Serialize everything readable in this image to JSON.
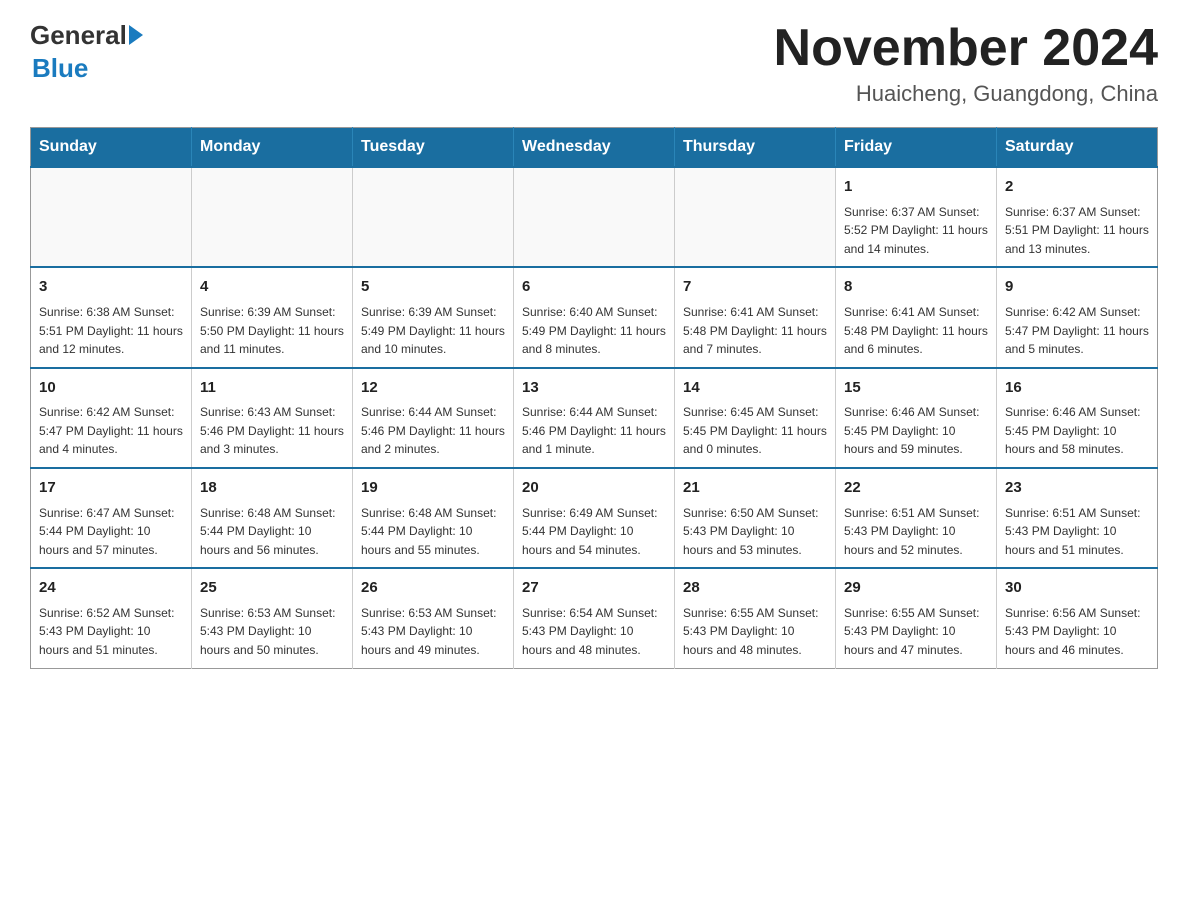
{
  "header": {
    "logo_general": "General",
    "logo_blue": "Blue",
    "month_title": "November 2024",
    "location": "Huaicheng, Guangdong, China"
  },
  "days_of_week": [
    "Sunday",
    "Monday",
    "Tuesday",
    "Wednesday",
    "Thursday",
    "Friday",
    "Saturday"
  ],
  "weeks": [
    [
      {
        "day": "",
        "info": ""
      },
      {
        "day": "",
        "info": ""
      },
      {
        "day": "",
        "info": ""
      },
      {
        "day": "",
        "info": ""
      },
      {
        "day": "",
        "info": ""
      },
      {
        "day": "1",
        "info": "Sunrise: 6:37 AM\nSunset: 5:52 PM\nDaylight: 11 hours and 14 minutes."
      },
      {
        "day": "2",
        "info": "Sunrise: 6:37 AM\nSunset: 5:51 PM\nDaylight: 11 hours and 13 minutes."
      }
    ],
    [
      {
        "day": "3",
        "info": "Sunrise: 6:38 AM\nSunset: 5:51 PM\nDaylight: 11 hours and 12 minutes."
      },
      {
        "day": "4",
        "info": "Sunrise: 6:39 AM\nSunset: 5:50 PM\nDaylight: 11 hours and 11 minutes."
      },
      {
        "day": "5",
        "info": "Sunrise: 6:39 AM\nSunset: 5:49 PM\nDaylight: 11 hours and 10 minutes."
      },
      {
        "day": "6",
        "info": "Sunrise: 6:40 AM\nSunset: 5:49 PM\nDaylight: 11 hours and 8 minutes."
      },
      {
        "day": "7",
        "info": "Sunrise: 6:41 AM\nSunset: 5:48 PM\nDaylight: 11 hours and 7 minutes."
      },
      {
        "day": "8",
        "info": "Sunrise: 6:41 AM\nSunset: 5:48 PM\nDaylight: 11 hours and 6 minutes."
      },
      {
        "day": "9",
        "info": "Sunrise: 6:42 AM\nSunset: 5:47 PM\nDaylight: 11 hours and 5 minutes."
      }
    ],
    [
      {
        "day": "10",
        "info": "Sunrise: 6:42 AM\nSunset: 5:47 PM\nDaylight: 11 hours and 4 minutes."
      },
      {
        "day": "11",
        "info": "Sunrise: 6:43 AM\nSunset: 5:46 PM\nDaylight: 11 hours and 3 minutes."
      },
      {
        "day": "12",
        "info": "Sunrise: 6:44 AM\nSunset: 5:46 PM\nDaylight: 11 hours and 2 minutes."
      },
      {
        "day": "13",
        "info": "Sunrise: 6:44 AM\nSunset: 5:46 PM\nDaylight: 11 hours and 1 minute."
      },
      {
        "day": "14",
        "info": "Sunrise: 6:45 AM\nSunset: 5:45 PM\nDaylight: 11 hours and 0 minutes."
      },
      {
        "day": "15",
        "info": "Sunrise: 6:46 AM\nSunset: 5:45 PM\nDaylight: 10 hours and 59 minutes."
      },
      {
        "day": "16",
        "info": "Sunrise: 6:46 AM\nSunset: 5:45 PM\nDaylight: 10 hours and 58 minutes."
      }
    ],
    [
      {
        "day": "17",
        "info": "Sunrise: 6:47 AM\nSunset: 5:44 PM\nDaylight: 10 hours and 57 minutes."
      },
      {
        "day": "18",
        "info": "Sunrise: 6:48 AM\nSunset: 5:44 PM\nDaylight: 10 hours and 56 minutes."
      },
      {
        "day": "19",
        "info": "Sunrise: 6:48 AM\nSunset: 5:44 PM\nDaylight: 10 hours and 55 minutes."
      },
      {
        "day": "20",
        "info": "Sunrise: 6:49 AM\nSunset: 5:44 PM\nDaylight: 10 hours and 54 minutes."
      },
      {
        "day": "21",
        "info": "Sunrise: 6:50 AM\nSunset: 5:43 PM\nDaylight: 10 hours and 53 minutes."
      },
      {
        "day": "22",
        "info": "Sunrise: 6:51 AM\nSunset: 5:43 PM\nDaylight: 10 hours and 52 minutes."
      },
      {
        "day": "23",
        "info": "Sunrise: 6:51 AM\nSunset: 5:43 PM\nDaylight: 10 hours and 51 minutes."
      }
    ],
    [
      {
        "day": "24",
        "info": "Sunrise: 6:52 AM\nSunset: 5:43 PM\nDaylight: 10 hours and 51 minutes."
      },
      {
        "day": "25",
        "info": "Sunrise: 6:53 AM\nSunset: 5:43 PM\nDaylight: 10 hours and 50 minutes."
      },
      {
        "day": "26",
        "info": "Sunrise: 6:53 AM\nSunset: 5:43 PM\nDaylight: 10 hours and 49 minutes."
      },
      {
        "day": "27",
        "info": "Sunrise: 6:54 AM\nSunset: 5:43 PM\nDaylight: 10 hours and 48 minutes."
      },
      {
        "day": "28",
        "info": "Sunrise: 6:55 AM\nSunset: 5:43 PM\nDaylight: 10 hours and 48 minutes."
      },
      {
        "day": "29",
        "info": "Sunrise: 6:55 AM\nSunset: 5:43 PM\nDaylight: 10 hours and 47 minutes."
      },
      {
        "day": "30",
        "info": "Sunrise: 6:56 AM\nSunset: 5:43 PM\nDaylight: 10 hours and 46 minutes."
      }
    ]
  ]
}
